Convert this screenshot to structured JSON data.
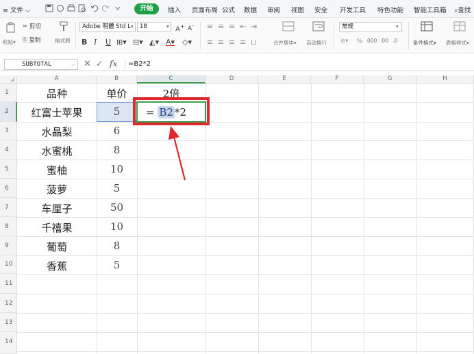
{
  "menubar": {
    "file": "文件",
    "start": "开始",
    "tabs": [
      "插入",
      "页面布局",
      "公式",
      "数据",
      "审阅",
      "视图",
      "安全",
      "开发工具",
      "特色功能",
      "智能工具箱"
    ],
    "search": "查找"
  },
  "ribbon": {
    "paste": "粘贴",
    "cut": "剪切",
    "copy": "复制",
    "format_painter": "格式刷",
    "font_name": "Adobe 明體 Std L",
    "font_size": "18",
    "merge": "合并居中",
    "wrap": "自动换行",
    "number_format": "常规",
    "conditional_format": "条件格式",
    "table_style": "表格样式"
  },
  "formula_bar": {
    "name_box": "SUBTOTAL",
    "fx": "fx",
    "formula": "=B2*2"
  },
  "columns": [
    "A",
    "B",
    "C",
    "D",
    "E",
    "F",
    "G",
    "H"
  ],
  "rows": [
    "1",
    "2",
    "3",
    "4",
    "5",
    "6",
    "7",
    "8",
    "9",
    "10",
    "11",
    "12",
    "13",
    "14"
  ],
  "table": {
    "header": {
      "a": "品种",
      "b": "单价",
      "c": "2倍"
    },
    "items": [
      {
        "a": "红富士苹果",
        "b": "5"
      },
      {
        "a": "水晶梨",
        "b": "6"
      },
      {
        "a": "水蜜桃",
        "b": "8"
      },
      {
        "a": "蜜柚",
        "b": "10"
      },
      {
        "a": "菠萝",
        "b": "5"
      },
      {
        "a": "车厘子",
        "b": "50"
      },
      {
        "a": "千禧果",
        "b": "10"
      },
      {
        "a": "葡萄",
        "b": "8"
      },
      {
        "a": "香蕉",
        "b": "5"
      }
    ]
  },
  "editing_cell": {
    "prefix": "=",
    "ref": "B2",
    "suffix": "*2"
  },
  "colors": {
    "accent_green": "#1fa042",
    "annotation_red": "#e0272b",
    "selection_blue": "#dce6f3"
  }
}
